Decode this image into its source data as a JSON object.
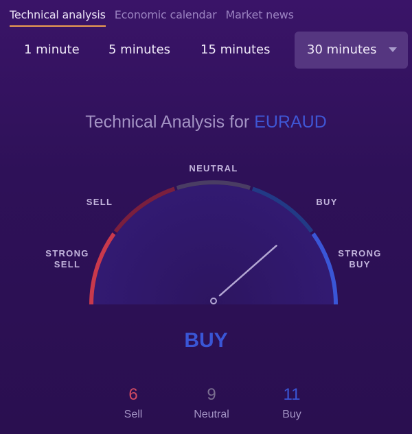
{
  "tabs": [
    {
      "label": "Technical analysis",
      "active": true
    },
    {
      "label": "Economic calendar",
      "active": false
    },
    {
      "label": "Market news",
      "active": false
    }
  ],
  "intervals": {
    "options": [
      "1 minute",
      "5 minutes",
      "15 minutes"
    ],
    "selected": "30 minutes"
  },
  "title": {
    "prefix": "Technical Analysis for",
    "symbol": "EURAUD"
  },
  "gauge": {
    "labels": {
      "strong_sell": [
        "STRONG",
        "SELL"
      ],
      "sell": "SELL",
      "neutral": "NEUTRAL",
      "buy": "BUY",
      "strong_buy": [
        "STRONG",
        "BUY"
      ]
    },
    "colors": {
      "strong_sell": "#c9394c",
      "sell": "#7a1f3e",
      "neutral": "#4a3d64",
      "buy": "#223a86",
      "strong_buy": "#3a56d6"
    },
    "needle_value": 0.3
  },
  "result": "BUY",
  "counts": [
    {
      "label": "Sell",
      "value": "6",
      "color": "#d14a62"
    },
    {
      "label": "Neutral",
      "value": "9",
      "color": "#7a6e90"
    },
    {
      "label": "Buy",
      "value": "11",
      "color": "#3a56d6"
    }
  ]
}
